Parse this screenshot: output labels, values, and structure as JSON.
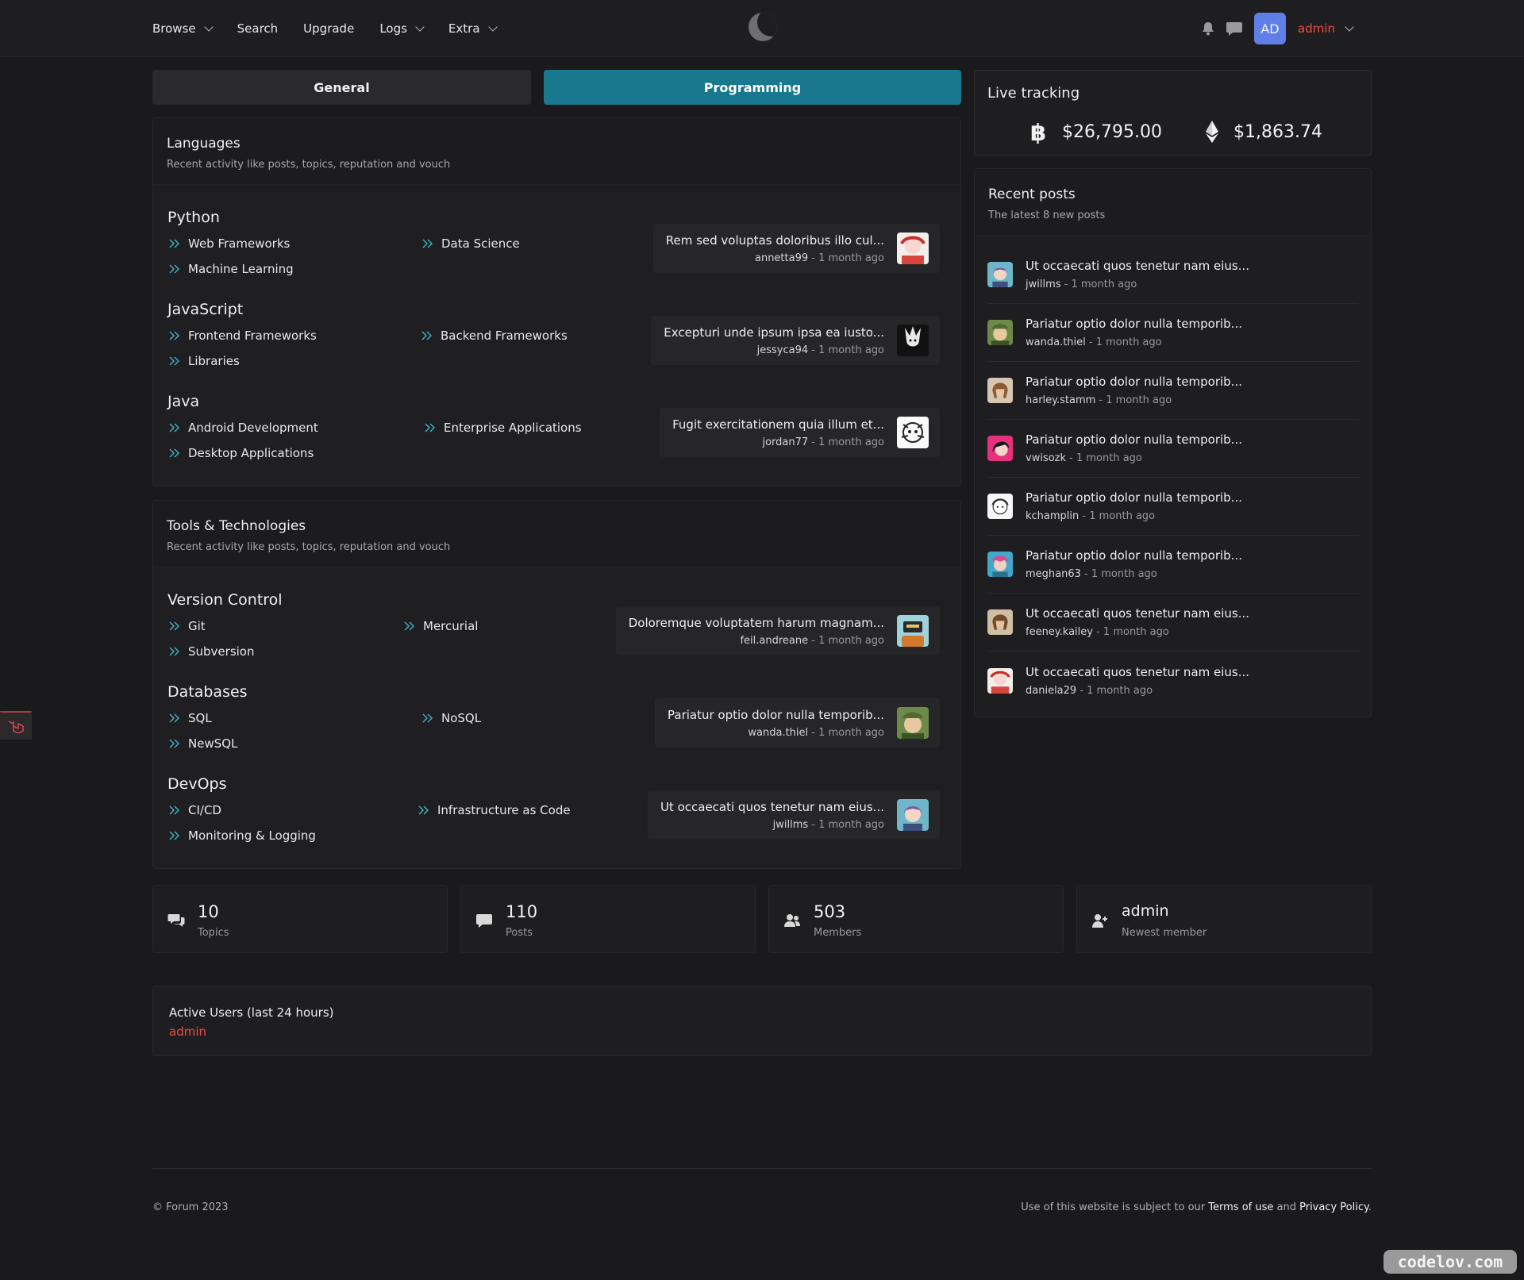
{
  "nav": {
    "browse": "Browse",
    "search": "Search",
    "upgrade": "Upgrade",
    "logs": "Logs",
    "extra": "Extra"
  },
  "user": {
    "initials": "AD",
    "name": "admin"
  },
  "tabs": {
    "general": "General",
    "programming": "Programming"
  },
  "live": {
    "title": "Live tracking",
    "btc": "$26,795.00",
    "eth": "$1,863.74"
  },
  "languages": {
    "title": "Languages",
    "subtitle": "Recent activity like posts, topics, reputation and vouch",
    "forums": [
      {
        "name": "Python",
        "subs": [
          "Web Frameworks",
          "Data Science",
          "Machine Learning"
        ],
        "latest": {
          "title": "Rem sed voluptas doloribus illo cul...",
          "user": "annetta99",
          "time": " - 1 month ago"
        }
      },
      {
        "name": "JavaScript",
        "subs": [
          "Frontend Frameworks",
          "Backend Frameworks",
          "Libraries"
        ],
        "latest": {
          "title": "Excepturi unde ipsum ipsa ea iusto...",
          "user": "jessyca94",
          "time": " - 1 month ago"
        }
      },
      {
        "name": "Java",
        "subs": [
          "Android Development",
          "Enterprise Applications",
          "Desktop Applications"
        ],
        "latest": {
          "title": "Fugit exercitationem quia illum et...",
          "user": "jordan77",
          "time": " - 1 month ago"
        }
      }
    ]
  },
  "tools": {
    "title": "Tools & Technologies",
    "subtitle": "Recent activity like posts, topics, reputation and vouch",
    "forums": [
      {
        "name": "Version Control",
        "subs": [
          "Git",
          "Mercurial",
          "Subversion"
        ],
        "latest": {
          "title": "Doloremque voluptatem harum magnam...",
          "user": "feil.andreane",
          "time": " - 1 month ago"
        }
      },
      {
        "name": "Databases",
        "subs": [
          "SQL",
          "NoSQL",
          "NewSQL"
        ],
        "latest": {
          "title": "Pariatur optio dolor nulla temporib...",
          "user": "wanda.thiel",
          "time": " - 1 month ago"
        }
      },
      {
        "name": "DevOps",
        "subs": [
          "CI/CD",
          "Infrastructure as Code",
          "Monitoring & Logging"
        ],
        "latest": {
          "title": "Ut occaecati quos tenetur nam eius...",
          "user": "jwillms",
          "time": " - 1 month ago"
        }
      }
    ]
  },
  "recent": {
    "title": "Recent posts",
    "subtitle": "The latest 8 new posts",
    "items": [
      {
        "title": "Ut occaecati quos tenetur nam eius...",
        "user": "jwillms",
        "time": " - 1 month ago"
      },
      {
        "title": "Pariatur optio dolor nulla temporib...",
        "user": "wanda.thiel",
        "time": " - 1 month ago"
      },
      {
        "title": "Pariatur optio dolor nulla temporib...",
        "user": "harley.stamm",
        "time": " - 1 month ago"
      },
      {
        "title": "Pariatur optio dolor nulla temporib...",
        "user": "vwisozk",
        "time": " - 1 month ago"
      },
      {
        "title": "Pariatur optio dolor nulla temporib...",
        "user": "kchamplin",
        "time": " - 1 month ago"
      },
      {
        "title": "Pariatur optio dolor nulla temporib...",
        "user": "meghan63",
        "time": " - 1 month ago"
      },
      {
        "title": "Ut occaecati quos tenetur nam eius...",
        "user": "feeney.kailey",
        "time": " - 1 month ago"
      },
      {
        "title": "Ut occaecati quos tenetur nam eius...",
        "user": "daniela29",
        "time": " - 1 month ago"
      }
    ]
  },
  "stats": {
    "topics": {
      "value": "10",
      "label": "Topics"
    },
    "posts": {
      "value": "110",
      "label": "Posts"
    },
    "members": {
      "value": "503",
      "label": "Members"
    },
    "newest": {
      "value": "admin",
      "label": "Newest member"
    }
  },
  "active": {
    "title": "Active Users (last 24 hours)",
    "user": "admin"
  },
  "footer": {
    "copyright": "© Forum 2023",
    "legal_prefix": "Use of this website is subject to our ",
    "terms": "Terms of use",
    "and": " and ",
    "privacy": "Privacy Policy",
    "end": "."
  },
  "watermark": "codelov.com",
  "colors": {
    "accent": "#17788e",
    "user": "#f04c43",
    "avatar_bg": "#5f7fe8"
  }
}
